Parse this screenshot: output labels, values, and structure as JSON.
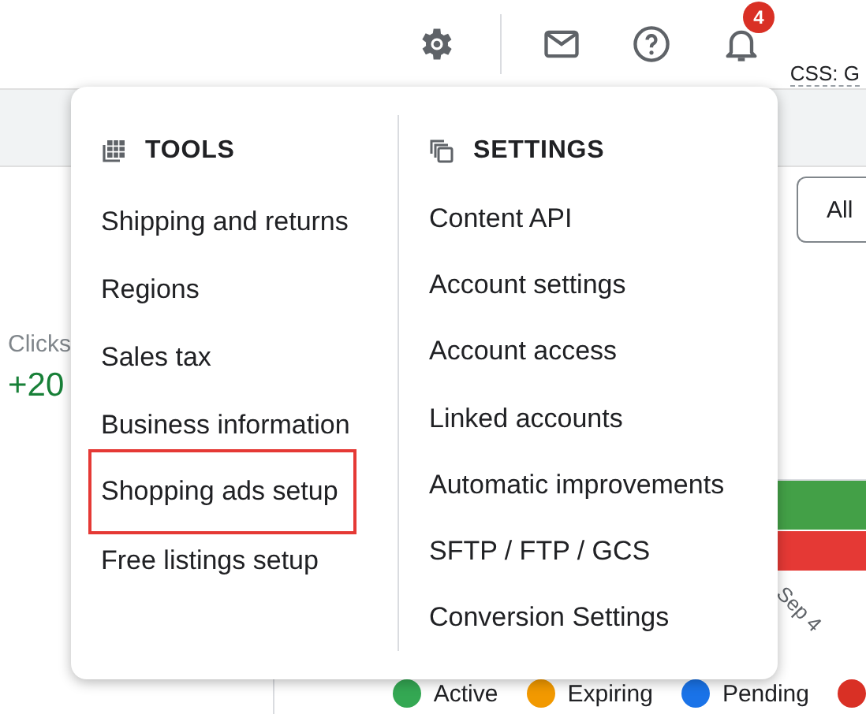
{
  "top_bar": {
    "notification_count": "4",
    "account_label": "CSS: G"
  },
  "background": {
    "filter_button": "All",
    "metric_label": "Clicks",
    "metric_value": "+20",
    "axis_labels": [
      "Sep 4"
    ],
    "legend": [
      {
        "label": "Active",
        "color": "#34a853"
      },
      {
        "label": "Expiring",
        "color": "#f29900"
      },
      {
        "label": "Pending",
        "color": "#1a73e8"
      },
      {
        "color": "#d93025"
      }
    ]
  },
  "menu": {
    "columns": [
      {
        "kind": "tools",
        "title": "TOOLS",
        "items": [
          {
            "label": "Shipping and returns",
            "highlighted": false
          },
          {
            "label": "Regions",
            "highlighted": false
          },
          {
            "label": "Sales tax",
            "highlighted": false
          },
          {
            "label": "Business information",
            "highlighted": false
          },
          {
            "label": "Shopping ads setup",
            "highlighted": true
          },
          {
            "label": "Free listings setup",
            "highlighted": false
          }
        ]
      },
      {
        "kind": "settings",
        "title": "SETTINGS",
        "items": [
          {
            "label": "Content API",
            "highlighted": false
          },
          {
            "label": "Account settings",
            "highlighted": false
          },
          {
            "label": "Account access",
            "highlighted": false
          },
          {
            "label": "Linked accounts",
            "highlighted": false
          },
          {
            "label": "Automatic improvements",
            "highlighted": false
          },
          {
            "label": "SFTP / FTP / GCS",
            "highlighted": false
          },
          {
            "label": "Conversion Settings",
            "highlighted": false
          }
        ]
      }
    ]
  }
}
